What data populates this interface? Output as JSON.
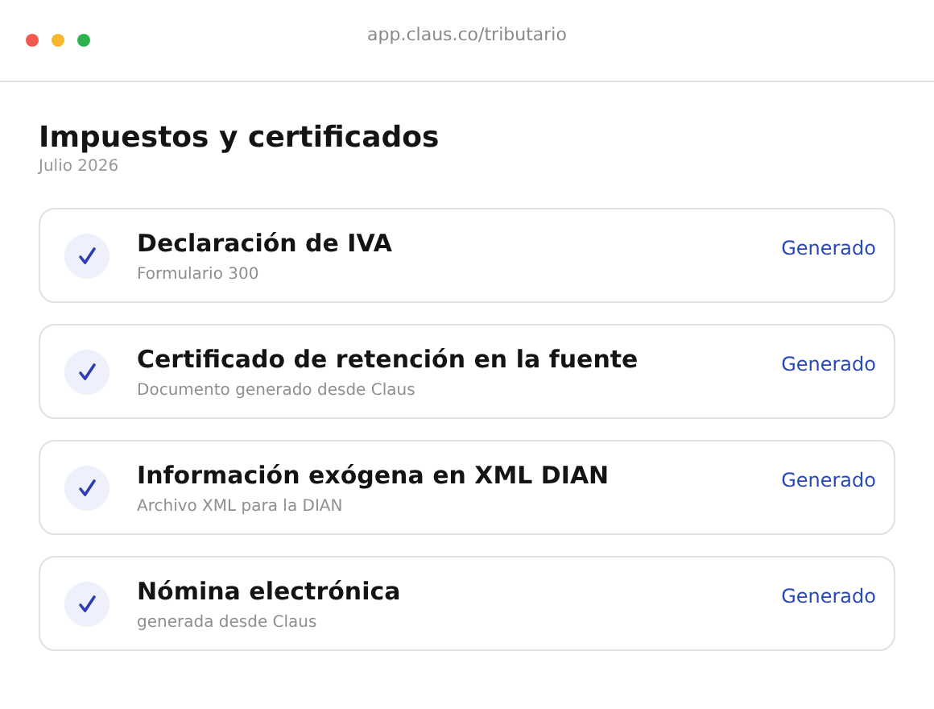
{
  "window": {
    "address": "app.claus.co/tributario"
  },
  "page": {
    "title": "Impuestos y certificados",
    "subtitle": "Julio 2026"
  },
  "items": [
    {
      "title": "Declaración de IVA",
      "subtitle": "Formulario 300",
      "status": "Generado"
    },
    {
      "title": "Certificado de retención en la fuente",
      "subtitle": "Documento generado desde Claus",
      "status": "Generado"
    },
    {
      "title": "Información exógena en XML DIAN",
      "subtitle": "Archivo XML para la DIAN",
      "status": "Generado"
    },
    {
      "title": "Nómina electrónica",
      "subtitle": "generada desde Claus",
      "status": "Generado"
    }
  ]
}
